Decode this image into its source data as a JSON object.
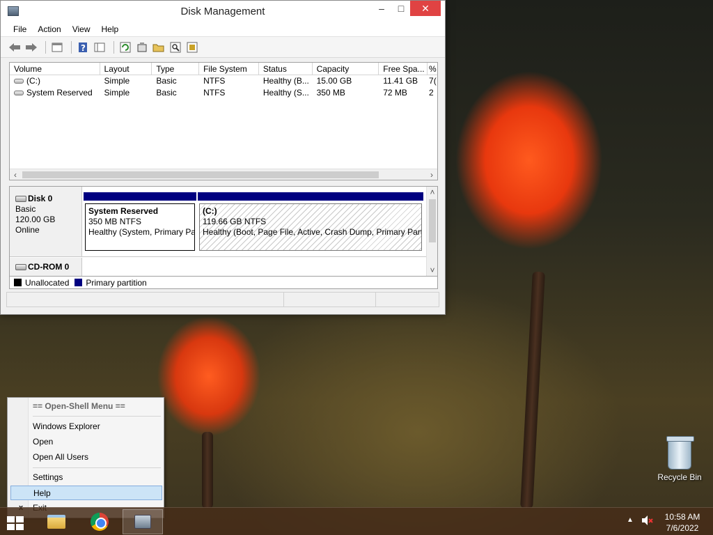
{
  "window": {
    "title": "Disk Management",
    "controls": {
      "minimize": "‒",
      "maximize": "□",
      "close": "✕"
    }
  },
  "menu": [
    "File",
    "Action",
    "View",
    "Help"
  ],
  "toolbar_icons": [
    "back-arrow-icon",
    "forward-arrow-icon",
    "properties-icon",
    "help-icon",
    "console-tree-icon",
    "refresh-icon",
    "rescan-icon",
    "open-icon",
    "search-icon",
    "settings-icon"
  ],
  "volumes": {
    "columns": [
      "Volume",
      "Layout",
      "Type",
      "File System",
      "Status",
      "Capacity",
      "Free Spa...",
      "%"
    ],
    "rows": [
      [
        "(C:)",
        "Simple",
        "Basic",
        "NTFS",
        "Healthy (B...",
        "15.00 GB",
        "11.41 GB",
        "7("
      ],
      [
        "System Reserved",
        "Simple",
        "Basic",
        "NTFS",
        "Healthy (S...",
        "350 MB",
        "72 MB",
        "2"
      ]
    ]
  },
  "disks": {
    "disk0": {
      "name": "Disk 0",
      "type": "Basic",
      "size": "120.00 GB",
      "status": "Online"
    },
    "cdrom": {
      "name": "CD-ROM 0"
    },
    "partitions": [
      {
        "title": "System Reserved",
        "detail": "350 MB NTFS",
        "status": "Healthy (System, Primary Pa"
      },
      {
        "title": "(C:)",
        "detail": "119.66 GB NTFS",
        "status": "Healthy (Boot, Page File, Active, Crash Dump, Primary Parti"
      }
    ]
  },
  "legend": {
    "unallocated": "Unallocated",
    "primary": "Primary partition",
    "colors": {
      "unallocated": "#000000",
      "primary": "#000080"
    }
  },
  "context_menu": {
    "header": "== Open-Shell Menu ==",
    "items": [
      "Windows Explorer",
      "Open",
      "Open All Users",
      "Settings",
      "Help",
      "Exit"
    ],
    "exit_glyph": "x",
    "highlighted": "Help"
  },
  "desktop": {
    "recycle_bin": "Recycle Bin"
  },
  "taskbar": {
    "time": "10:58 AM",
    "date": "7/6/2022"
  }
}
